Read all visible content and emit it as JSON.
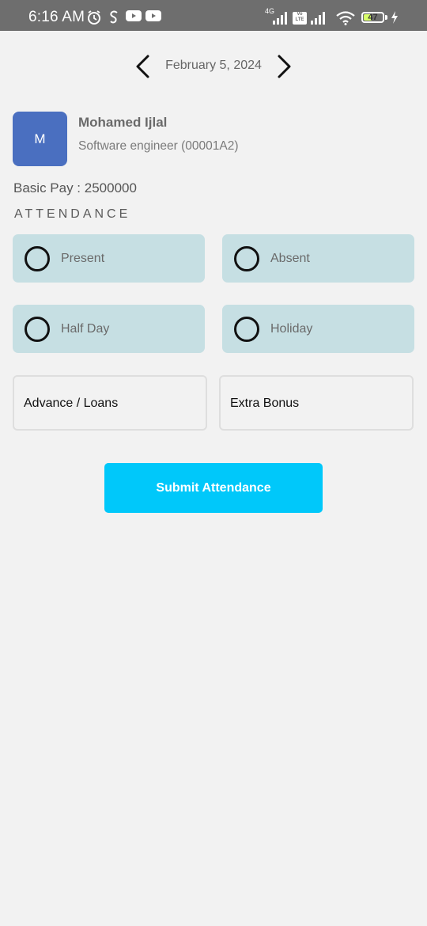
{
  "status_bar": {
    "time": "6:16 AM",
    "battery": "47",
    "battery_level_percent": 47,
    "network": "4G",
    "volte": "Vo LTE",
    "icons": [
      "alarm-icon",
      "app-icon",
      "youtube-icon",
      "youtube-icon",
      "signal-icon",
      "wifi-icon",
      "battery-icon",
      "charging-icon"
    ]
  },
  "date_nav": {
    "date": "February 5, 2024",
    "prev_icon": "chevron-left-icon",
    "next_icon": "chevron-right-icon"
  },
  "employee": {
    "initial": "M",
    "name": "Mohamed Ijlal",
    "role": "Software engineer (00001A2)",
    "avatar_color": "#4a6fc0"
  },
  "basic_pay": "Basic Pay : 2500000",
  "attendance": {
    "title": "ATTENDANCE",
    "options": [
      {
        "label": "Present",
        "selected": false
      },
      {
        "label": "Absent",
        "selected": false
      },
      {
        "label": "Half Day",
        "selected": false
      },
      {
        "label": "Holiday",
        "selected": false
      }
    ],
    "option_color": "#c6dfe3"
  },
  "inputs": {
    "advance_placeholder": "Advance / Loans",
    "bonus_placeholder": "Extra Bonus"
  },
  "submit": {
    "label": "Submit Attendance",
    "color": "#00c8fa"
  }
}
